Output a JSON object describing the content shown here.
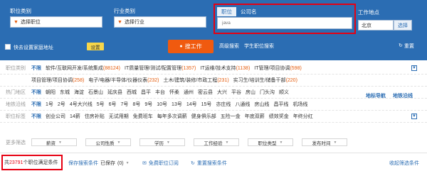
{
  "search": {
    "labels": {
      "category": "职位类别",
      "industry": "行业类别",
      "location": "工作地点"
    },
    "category_value": "选择职位",
    "industry_value": "选择行业",
    "keyword_tabs": [
      "职位",
      "公司名"
    ],
    "keyword_placeholder": "java",
    "location_value": "北京",
    "location_button": "选择",
    "home_address_label": "快去设置家庭地址",
    "set_button": "设置",
    "search_button": "搜工作",
    "advanced": "高级搜索",
    "student": "学生职位搜索",
    "reset": "重置"
  },
  "filters": [
    {
      "label": "职位类别",
      "items": [
        {
          "t": "不限",
          "bold": true
        },
        {
          "t": "软件/互联网开发/系统集成",
          "c": "(88124)"
        },
        {
          "t": "IT质量管理/测试/配置管理",
          "c": "(1357)"
        },
        {
          "t": "IT运维/技术支持",
          "c": "(1138)"
        },
        {
          "t": "IT管理/项目协调",
          "c": "(598)"
        }
      ]
    },
    {
      "label": "",
      "items": [
        {
          "t": "项目管理/项目协调",
          "c": "(258)"
        },
        {
          "t": "电子/电器/半导体/仪器仪表",
          "c": "(232)"
        },
        {
          "t": "土木/建筑/装修/市政工程",
          "c": "(231)"
        },
        {
          "t": "实习生/培训生/储备干部",
          "c": "(220)"
        }
      ]
    },
    {
      "label": "热门地区",
      "items": [
        {
          "t": "不限",
          "bold": true
        },
        {
          "t": "朝阳"
        },
        {
          "t": "东城"
        },
        {
          "t": "海淀"
        },
        {
          "t": "石景山"
        },
        {
          "t": "延庆县"
        },
        {
          "t": "西城"
        },
        {
          "t": "昌平"
        },
        {
          "t": "丰台"
        },
        {
          "t": "怀柔"
        },
        {
          "t": "通州"
        },
        {
          "t": "密云县"
        },
        {
          "t": "大兴"
        },
        {
          "t": "平谷"
        },
        {
          "t": "房山"
        },
        {
          "t": "门头沟"
        },
        {
          "t": "顺义"
        }
      ]
    },
    {
      "label": "地铁沿线",
      "items": [
        {
          "t": "不限",
          "bold": true
        },
        {
          "t": "1号"
        },
        {
          "t": "2号"
        },
        {
          "t": "4号大兴线"
        },
        {
          "t": "5号"
        },
        {
          "t": "6号"
        },
        {
          "t": "7号"
        },
        {
          "t": "8号"
        },
        {
          "t": "9号"
        },
        {
          "t": "10号"
        },
        {
          "t": "13号"
        },
        {
          "t": "14号"
        },
        {
          "t": "15号"
        },
        {
          "t": "亦庄线"
        },
        {
          "t": "八通线"
        },
        {
          "t": "房山线"
        },
        {
          "t": "昌平线"
        },
        {
          "t": "机场线"
        }
      ]
    },
    {
      "label": "职位标签",
      "items": [
        {
          "t": "不限",
          "bold": true
        },
        {
          "t": "创业公司"
        },
        {
          "t": "14薪"
        },
        {
          "t": "住房补贴"
        },
        {
          "t": "无试用期"
        },
        {
          "t": "免费班车"
        },
        {
          "t": "每年多次调薪"
        },
        {
          "t": "健身俱乐部"
        },
        {
          "t": "五险一金"
        },
        {
          "t": "年底双薪"
        },
        {
          "t": "绩效奖金"
        },
        {
          "t": "年终分红"
        }
      ]
    }
  ],
  "area_links": [
    "地标导航",
    "地铁沿线"
  ],
  "more": {
    "label": "更多筛选",
    "dropdowns": [
      "薪资",
      "公司性质",
      "学历",
      "工作经验",
      "职位类型",
      "发布时间"
    ]
  },
  "bottom": {
    "count": "23791",
    "count_prefix": "共",
    "count_suffix": "个职位满足条件",
    "save_cond": "保存搜索条件",
    "saved": "已保存",
    "saved_count": "(0)",
    "subscribe": "免费职位订阅",
    "reset_cond": "重置搜索条件",
    "collapse": "收起筛选条件"
  }
}
